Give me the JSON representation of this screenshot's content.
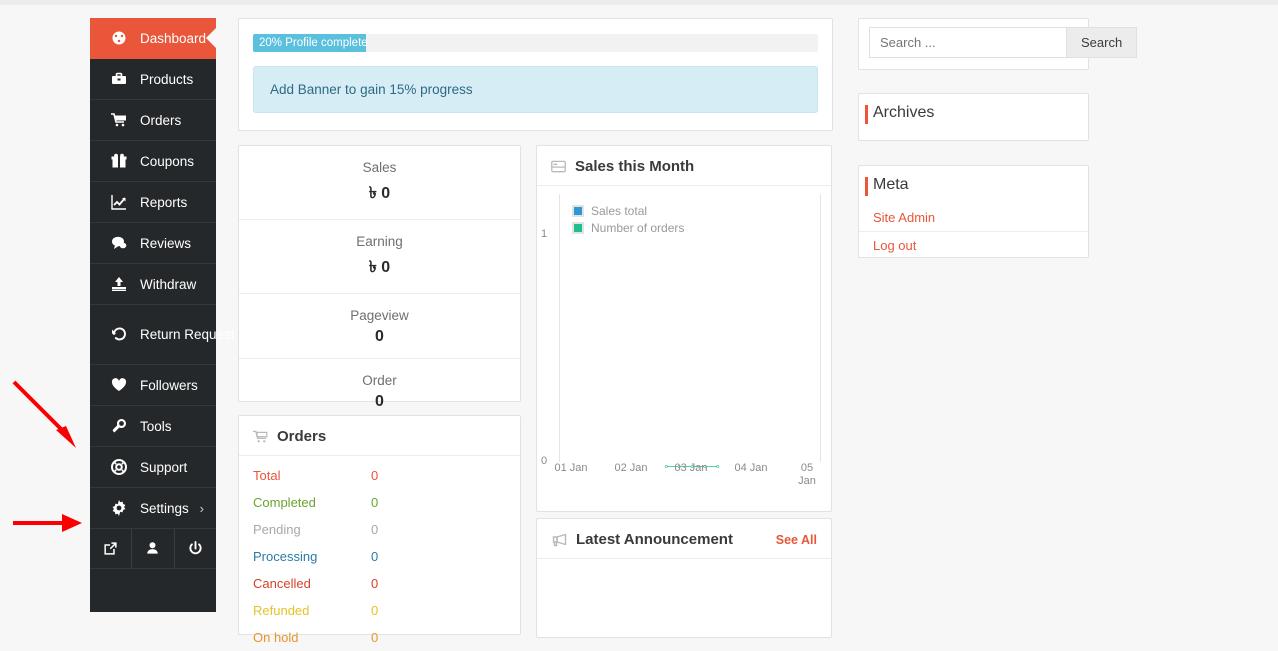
{
  "sidebar": {
    "items": [
      {
        "label": "Dashboard",
        "icon": "dashboard-icon",
        "active": true
      },
      {
        "label": "Products",
        "icon": "briefcase-icon",
        "active": false
      },
      {
        "label": "Orders",
        "icon": "cart-icon",
        "active": false
      },
      {
        "label": "Coupons",
        "icon": "gift-icon",
        "active": false
      },
      {
        "label": "Reports",
        "icon": "chart-line-icon",
        "active": false
      },
      {
        "label": "Reviews",
        "icon": "comment-icon",
        "active": false
      },
      {
        "label": "Withdraw",
        "icon": "upload-icon",
        "active": false
      },
      {
        "label": "Return Request",
        "icon": "undo-icon",
        "active": false
      },
      {
        "label": "Followers",
        "icon": "heart-icon",
        "active": false
      },
      {
        "label": "Tools",
        "icon": "wrench-icon",
        "active": false
      },
      {
        "label": "Support",
        "icon": "lifering-icon",
        "active": false
      },
      {
        "label": "Settings",
        "icon": "gear-icon",
        "active": false,
        "chevron": "›"
      }
    ],
    "bottom_icons": [
      "external-link-icon",
      "user-icon",
      "power-icon"
    ]
  },
  "profile": {
    "progress_label": "20% Profile complete",
    "progress_percent": 20,
    "notice": "Add Banner to gain 15% progress",
    "progress_color": "#5bc0de"
  },
  "stats": [
    {
      "label": "Sales",
      "value": "৳ 0"
    },
    {
      "label": "Earning",
      "value": "৳ 0"
    },
    {
      "label": "Pageview",
      "value": "0"
    },
    {
      "label": "Order",
      "value": "0"
    }
  ],
  "orders": {
    "title": "Orders",
    "icon": "cart-icon",
    "rows": [
      {
        "name": "Total",
        "count": "0",
        "color": "#e9563a"
      },
      {
        "name": "Completed",
        "count": "0",
        "color": "#6aa32f"
      },
      {
        "name": "Pending",
        "count": "0",
        "color": "#a8a8a8"
      },
      {
        "name": "Processing",
        "count": "0",
        "color": "#2a7ba8"
      },
      {
        "name": "Cancelled",
        "count": "0",
        "color": "#d4432a"
      },
      {
        "name": "Refunded",
        "count": "0",
        "color": "#e6c229"
      },
      {
        "name": "On hold",
        "count": "0",
        "color": "#e8972a"
      }
    ]
  },
  "chart_panel": {
    "title": "Sales this Month",
    "icon": "report-icon"
  },
  "chart_data": {
    "type": "line",
    "title": "Sales this Month",
    "categories": [
      "01 Jan",
      "02 Jan",
      "03 Jan",
      "04 Jan",
      "05 Jan"
    ],
    "series": [
      {
        "name": "Sales total",
        "values": [
          0,
          0,
          0,
          0,
          0
        ],
        "color": "#2f96d8"
      },
      {
        "name": "Number of orders",
        "values": [
          0,
          0,
          0,
          0,
          0
        ],
        "color": "#1fbf8f"
      }
    ],
    "yticks": [
      "1",
      "0"
    ],
    "ylim": [
      0,
      1
    ],
    "xlabel": "",
    "ylabel": "",
    "grid": false,
    "legend_position": "top-left"
  },
  "announcement": {
    "title": "Latest Announcement",
    "icon": "megaphone-icon",
    "see_all": "See All"
  },
  "search": {
    "placeholder": "Search ...",
    "value": "",
    "button": "Search"
  },
  "archives": {
    "title": "Archives"
  },
  "meta": {
    "title": "Meta",
    "links": [
      "Site Admin",
      "Log out"
    ]
  },
  "annotations": {
    "arrow_color": "#fa0000",
    "arrows": [
      "arrow-pointing-to-tools",
      "arrow-pointing-to-settings"
    ]
  }
}
